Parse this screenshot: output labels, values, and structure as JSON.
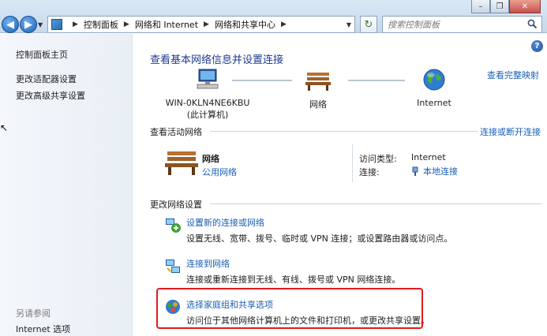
{
  "window": {
    "minimize_glyph": "–",
    "maximize_glyph": "❐",
    "close_glyph": "✕"
  },
  "address_bar": {
    "crumbs": [
      "控制面板",
      "网络和 Internet",
      "网络和共享中心"
    ],
    "search_placeholder": "搜索控制面板"
  },
  "sidebar": {
    "links": [
      "控制面板主页",
      "更改适配器设置",
      "更改高级共享设置"
    ],
    "see_also_label": "另请参阅",
    "see_also_links": [
      "Internet 选项"
    ]
  },
  "main": {
    "title": "查看基本网络信息并设置连接",
    "full_map_link": "查看完整映射",
    "nodes": [
      {
        "label": "WIN-0KLN4NE6KBU",
        "sublabel": "(此计算机)"
      },
      {
        "label": "网络"
      },
      {
        "label": "Internet"
      }
    ],
    "active_section": {
      "title": "查看活动网络",
      "action_link": "连接或断开连接",
      "network_name": "网络",
      "network_type": "公用网络",
      "access_type_label": "访问类型:",
      "access_type_value": "Internet",
      "connection_label": "连接:",
      "connection_value": "本地连接"
    },
    "change_section": {
      "title": "更改网络设置",
      "tasks": [
        {
          "title": "设置新的连接或网络",
          "desc": "设置无线、宽带、拨号、临时或 VPN 连接；或设置路由器或访问点。"
        },
        {
          "title": "连接到网络",
          "desc": "连接或重新连接到无线、有线、拨号或 VPN 网络连接。"
        },
        {
          "title": "选择家庭组和共享选项",
          "desc": "访问位于其他网络计算机上的文件和打印机，或更改共享设置。"
        }
      ]
    }
  },
  "colors": {
    "link": "#1a5fb4",
    "title": "#1e3a8f",
    "highlight": "#e11a1a"
  }
}
